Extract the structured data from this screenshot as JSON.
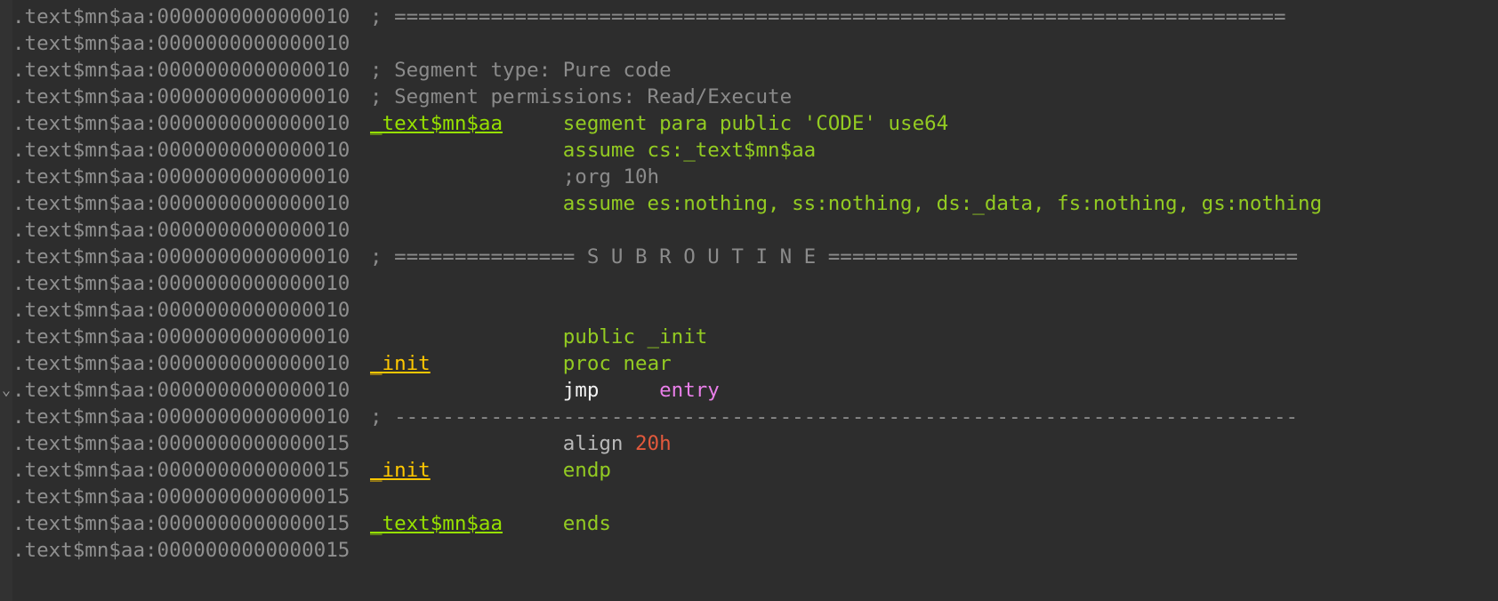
{
  "view": {
    "name": "IDA Pro disassembly listing",
    "background_color": "#2d2d2d",
    "gutter_color": "#323232"
  },
  "colors": {
    "address": "#8f8f8f",
    "comment": "#8b8b8b",
    "keyword": "#93cb22",
    "segment_name": "#96e000",
    "function_name": "#ffc800",
    "instruction": "#f2f2f2",
    "location_ref": "#e97fe9",
    "number": "#e2593c"
  },
  "segment_prefix": ".text$mn$aa",
  "addresses": {
    "a10": ".text$mn$aa:0000000000000010",
    "a15": ".text$mn$aa:0000000000000015"
  },
  "glyphs": {
    "jump_arrow": "⌄"
  },
  "lines": [
    {
      "arrow": "",
      "address": ".text$mn$aa:0000000000000010",
      "tokens": [
        {
          "cls": "cmt",
          "text": "; =========================================================================="
        }
      ]
    },
    {
      "arrow": "",
      "address": ".text$mn$aa:0000000000000010",
      "tokens": []
    },
    {
      "arrow": "",
      "address": ".text$mn$aa:0000000000000010",
      "tokens": [
        {
          "cls": "cmt",
          "text": "; Segment type: Pure code"
        }
      ]
    },
    {
      "arrow": "",
      "address": ".text$mn$aa:0000000000000010",
      "tokens": [
        {
          "cls": "cmt",
          "text": "; Segment permissions: Read/Execute"
        }
      ]
    },
    {
      "arrow": "",
      "address": ".text$mn$aa:0000000000000010",
      "tokens": [
        {
          "cls": "segnm",
          "text": "_text$mn$aa"
        },
        {
          "cls": "kw",
          "text": "     segment para public 'CODE' use64"
        }
      ]
    },
    {
      "arrow": "",
      "address": ".text$mn$aa:0000000000000010",
      "tokens": [
        {
          "cls": "kw",
          "text": "                assume cs:_text$mn$aa"
        }
      ]
    },
    {
      "arrow": "",
      "address": ".text$mn$aa:0000000000000010",
      "tokens": [
        {
          "cls": "cmt",
          "text": "                ;org 10h"
        }
      ]
    },
    {
      "arrow": "",
      "address": ".text$mn$aa:0000000000000010",
      "tokens": [
        {
          "cls": "kw",
          "text": "                assume es:nothing, ss:nothing, ds:_data, fs:nothing, gs:nothing"
        }
      ]
    },
    {
      "arrow": "",
      "address": ".text$mn$aa:0000000000000010",
      "tokens": []
    },
    {
      "arrow": "",
      "address": ".text$mn$aa:0000000000000010",
      "tokens": [
        {
          "cls": "cmt",
          "text": "; =============== S U B R O U T I N E ======================================="
        }
      ]
    },
    {
      "arrow": "",
      "address": ".text$mn$aa:0000000000000010",
      "tokens": []
    },
    {
      "arrow": "",
      "address": ".text$mn$aa:0000000000000010",
      "tokens": []
    },
    {
      "arrow": "",
      "address": ".text$mn$aa:0000000000000010",
      "tokens": [
        {
          "cls": "kw",
          "text": "                public _init"
        }
      ]
    },
    {
      "arrow": "",
      "address": ".text$mn$aa:0000000000000010",
      "tokens": [
        {
          "cls": "fnnm",
          "text": "_init"
        },
        {
          "cls": "kw",
          "text": "           proc near"
        }
      ]
    },
    {
      "arrow": "⌄",
      "address": ".text$mn$aa:0000000000000010",
      "tokens": [
        {
          "cls": "instr",
          "text": "                jmp     "
        },
        {
          "cls": "locref",
          "text": "entry"
        }
      ]
    },
    {
      "arrow": "",
      "address": ".text$mn$aa:0000000000000010",
      "tokens": [
        {
          "cls": "cmt",
          "text": "; ---------------------------------------------------------------------------"
        }
      ]
    },
    {
      "arrow": "",
      "address": ".text$mn$aa:0000000000000015",
      "tokens": [
        {
          "cls": "plain",
          "text": "                align "
        },
        {
          "cls": "num",
          "text": "20h"
        }
      ]
    },
    {
      "arrow": "",
      "address": ".text$mn$aa:0000000000000015",
      "tokens": [
        {
          "cls": "fnnm",
          "text": "_init"
        },
        {
          "cls": "kw",
          "text": "           endp"
        }
      ]
    },
    {
      "arrow": "",
      "address": ".text$mn$aa:0000000000000015",
      "tokens": []
    },
    {
      "arrow": "",
      "address": ".text$mn$aa:0000000000000015",
      "tokens": [
        {
          "cls": "segnm",
          "text": "_text$mn$aa"
        },
        {
          "cls": "kw",
          "text": "     ends"
        }
      ]
    },
    {
      "arrow": "",
      "address": ".text$mn$aa:0000000000000015",
      "tokens": []
    }
  ]
}
